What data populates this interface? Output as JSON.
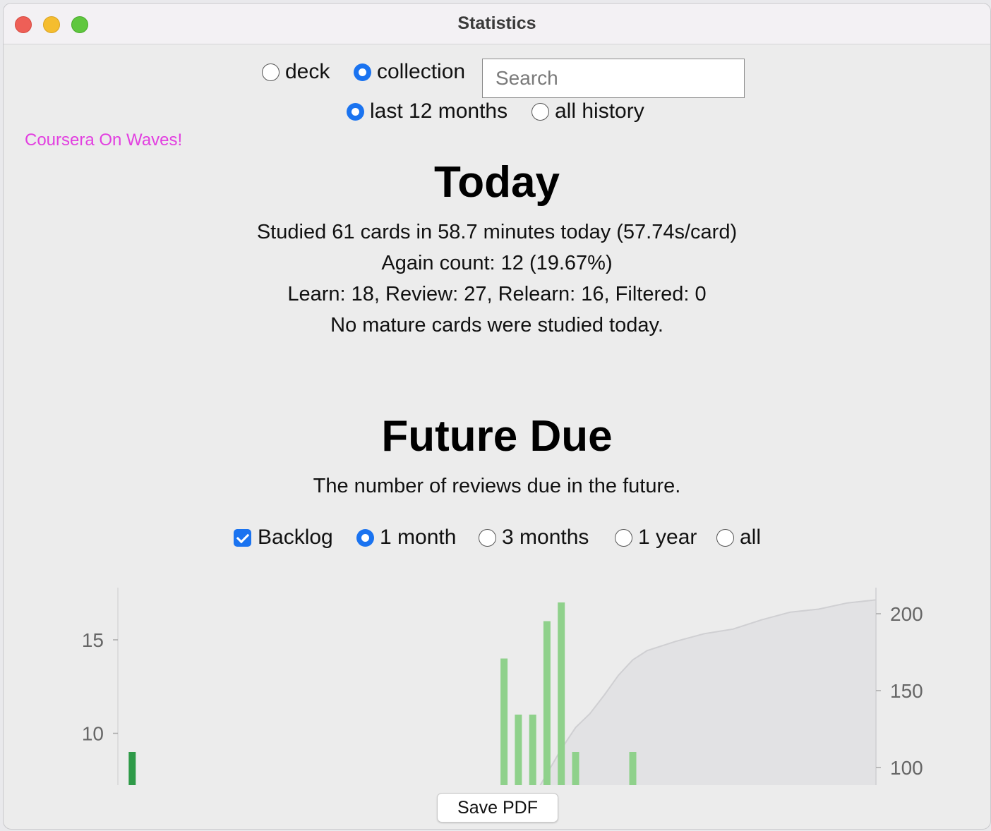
{
  "window": {
    "title": "Statistics"
  },
  "controls": {
    "scope_deck": "deck",
    "scope_collection": "collection",
    "search_placeholder": "Search",
    "period_12": "last 12 months",
    "period_all": "all history"
  },
  "sidebar_link": "Coursera On Waves!",
  "today": {
    "heading": "Today",
    "line1": "Studied 61 cards in 58.7 minutes today (57.74s/card)",
    "line2": "Again count: 12 (19.67%)",
    "line3": "Learn: 18, Review: 27, Relearn: 16, Filtered: 0",
    "line4": "No mature cards were studied today."
  },
  "future_due": {
    "heading": "Future Due",
    "description": "The number of reviews due in the future.",
    "options": {
      "backlog": "Backlog",
      "m1": "1 month",
      "m3": "3 months",
      "y1": "1 year",
      "all": "all"
    }
  },
  "save_button": "Save PDF",
  "colors": {
    "accent": "#1a73f0",
    "link": "#e23fe0",
    "bar_dark": "#2e9a48",
    "bar_light": "#8fd18b",
    "cumulative": "#e0e0e2"
  },
  "chart_data": {
    "type": "bar",
    "left_axis": {
      "ticks": [
        10,
        15
      ]
    },
    "right_axis": {
      "ticks": [
        100,
        150,
        200
      ]
    },
    "bars": [
      {
        "day": -26,
        "value": 9,
        "color": "#2e9a48"
      },
      {
        "day": 0,
        "value": 14,
        "color": "#8fd18b"
      },
      {
        "day": 1,
        "value": 11,
        "color": "#8fd18b"
      },
      {
        "day": 2,
        "value": 11,
        "color": "#8fd18b"
      },
      {
        "day": 3,
        "value": 16,
        "color": "#8fd18b"
      },
      {
        "day": 4,
        "value": 17,
        "color": "#8fd18b"
      },
      {
        "day": 5,
        "value": 9,
        "color": "#8fd18b"
      },
      {
        "day": 9,
        "value": 9,
        "color": "#8fd18b"
      }
    ],
    "cumulative": [
      [
        2,
        80
      ],
      [
        3,
        96
      ],
      [
        4,
        112
      ],
      [
        5,
        126
      ],
      [
        6,
        135
      ],
      [
        7,
        147
      ],
      [
        8,
        160
      ],
      [
        9,
        170
      ],
      [
        10,
        176
      ],
      [
        12,
        182
      ],
      [
        14,
        187
      ],
      [
        16,
        190
      ],
      [
        18,
        196
      ],
      [
        20,
        201
      ],
      [
        22,
        203
      ],
      [
        24,
        207
      ],
      [
        26,
        209
      ]
    ]
  }
}
